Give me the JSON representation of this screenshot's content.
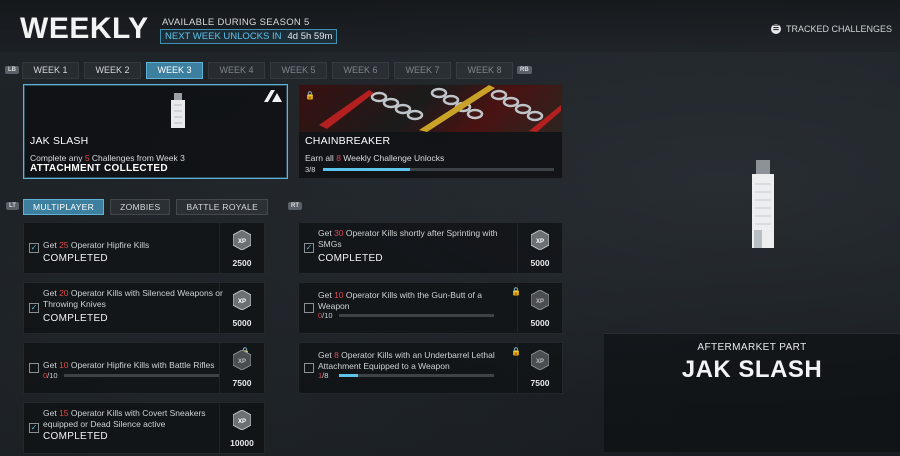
{
  "header": {
    "title": "WEEKLY",
    "season_text": "AVAILABLE DURING SEASON 5",
    "next_unlock_label": "NEXT WEEK UNLOCKS IN",
    "next_unlock_timer": "4d 5h 59m",
    "tracked_label": "TRACKED CHALLENGES"
  },
  "hints": {
    "lb": "LB",
    "rb": "RB",
    "lt": "LT",
    "rt": "RT"
  },
  "week_tabs": [
    {
      "label": "WEEK 1"
    },
    {
      "label": "WEEK 2"
    },
    {
      "label": "WEEK 3"
    },
    {
      "label": "WEEK 4"
    },
    {
      "label": "WEEK 5"
    },
    {
      "label": "WEEK 6"
    },
    {
      "label": "WEEK 7"
    },
    {
      "label": "WEEK 8"
    }
  ],
  "active_week": "WEEK 3",
  "rewards": [
    {
      "name": "JAK SLASH",
      "desc_pre": "Complete any ",
      "desc_num": "5",
      "desc_post": " Challenges from Week 3",
      "status": "ATTACHMENT COLLECTED"
    },
    {
      "name": "CHAINBREAKER",
      "desc_pre": "Earn all ",
      "desc_num": "8",
      "desc_post": " Weekly Challenge Unlocks",
      "progress_text": "3/8",
      "progress": 0.375
    }
  ],
  "mode_tabs": [
    {
      "label": "MULTIPLAYER"
    },
    {
      "label": "ZOMBIES"
    },
    {
      "label": "BATTLE ROYALE"
    }
  ],
  "challenges": [
    {
      "pre": "Get ",
      "num": "25",
      "post": " Operator Hipfire Kills",
      "status": "COMPLETED",
      "xp": "2500"
    },
    {
      "pre": "Get ",
      "num": "30",
      "post": " Operator Kills shortly after Sprinting with SMGs",
      "status": "COMPLETED",
      "xp": "5000"
    },
    {
      "pre": "Get ",
      "num": "20",
      "post": " Operator Kills with Silenced Weapons or Throwing Knives",
      "status": "COMPLETED",
      "xp": "5000"
    },
    {
      "pre": "Get ",
      "num": "10",
      "post": " Operator Kills with the Gun-Butt of a Weapon",
      "progress_current": "0",
      "progress_total": "/10",
      "progress": 0,
      "xp": "5000"
    },
    {
      "pre": "Get ",
      "num": "10",
      "post": " Operator Hipfire Kills with Battle Rifles",
      "progress_current": "0",
      "progress_total": "/10",
      "progress": 0,
      "xp": "7500"
    },
    {
      "pre": "Get ",
      "num": "8",
      "post": " Operator Kills with an Underbarrel Lethal Attachment Equipped to a Weapon",
      "progress_current": "1",
      "progress_total": "/8",
      "progress": 0.125,
      "xp": "7500"
    },
    {
      "pre": "Get ",
      "num": "15",
      "post": " Operator Kills with Covert Sneakers equipped or Dead Silence active",
      "status": "COMPLETED",
      "xp": "10000"
    }
  ],
  "xp_icon_label": "XP",
  "preview": {
    "type": "AFTERMARKET PART",
    "name": "JAK SLASH"
  },
  "colors": {
    "accent": "#5cc3ea",
    "active_tab": "#3d7f9e",
    "highlight_number": "#e04848"
  }
}
